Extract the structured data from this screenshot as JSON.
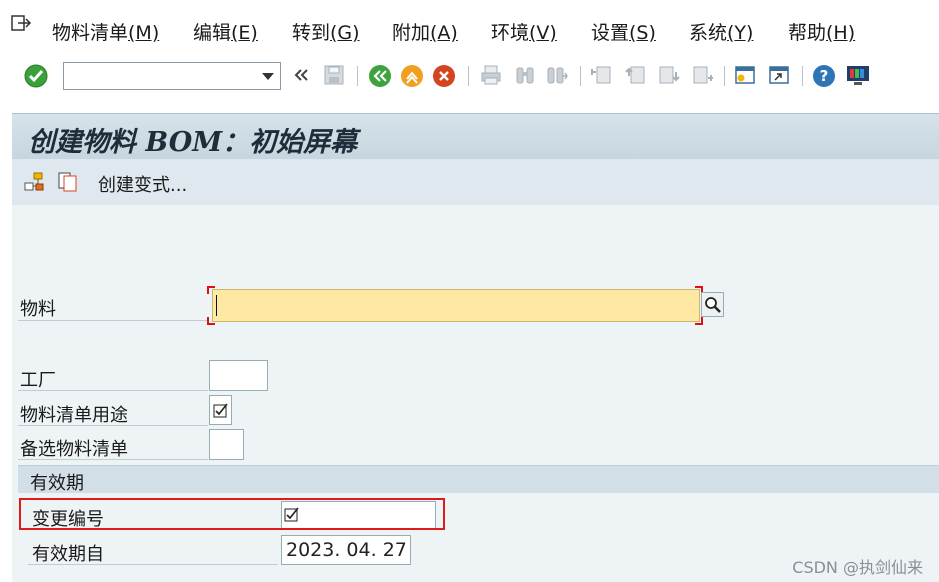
{
  "menubar": {
    "items": [
      {
        "label": "物料清单",
        "accel": "(M)"
      },
      {
        "label": "编辑",
        "accel": "(E)"
      },
      {
        "label": "转到",
        "accel": "(G)"
      },
      {
        "label": "附加",
        "accel": "(A)"
      },
      {
        "label": "环境",
        "accel": "(V)"
      },
      {
        "label": "设置",
        "accel": "(S)"
      },
      {
        "label": "系统",
        "accel": "(Y)"
      },
      {
        "label": "帮助",
        "accel": "(H)"
      }
    ]
  },
  "toolbar": {
    "command_value": "",
    "icons": [
      "enter-icon",
      "command-field",
      "collapse-icon",
      "save-icon",
      "back-icon",
      "exit-icon",
      "cancel-icon",
      "print-icon",
      "find-icon",
      "find-next-icon",
      "first-page-icon",
      "prev-page-icon",
      "next-page-icon",
      "last-page-icon",
      "new-session-icon",
      "shortcut-icon",
      "help-icon",
      "layout-icon"
    ]
  },
  "title": "创建物料 BOM：初始屏幕",
  "appbar": {
    "icons": [
      "hierarchy-icon",
      "copy-icon"
    ],
    "button_label": "创建变式..."
  },
  "form": {
    "material_label": "物料",
    "material_value": "",
    "plant_label": "工厂",
    "plant_value": "",
    "bom_usage_label": "物料清单用途",
    "alt_bom_label": "备选物料清单",
    "alt_bom_value": "",
    "validity_group": "有效期",
    "change_number_label": "变更编号",
    "valid_from_label": "有效期自",
    "valid_from_value": "2023. 04. 27"
  },
  "watermark": "CSDN @执剑仙来",
  "colors": {
    "title_bg": "#c9d8e2",
    "required_field": "#fde9a4",
    "highlight_box": "#e0191a"
  }
}
